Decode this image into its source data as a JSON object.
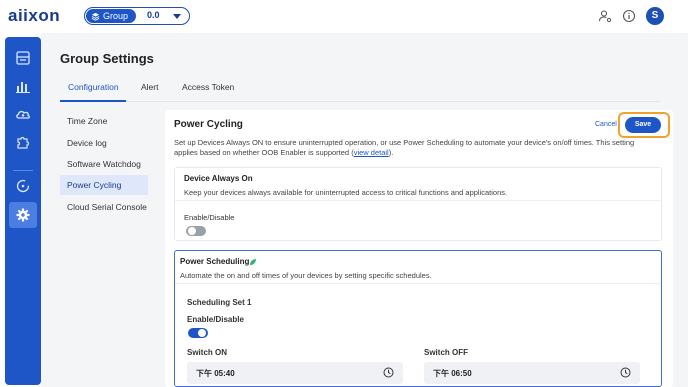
{
  "brand": {
    "logo_text": "aiixon"
  },
  "group_selector": {
    "label": "Group",
    "value": "0.0"
  },
  "user": {
    "avatar_initial": "S"
  },
  "page": {
    "title": "Group Settings",
    "tabs": [
      {
        "label": "Configuration",
        "active": true
      },
      {
        "label": "Alert",
        "active": false
      },
      {
        "label": "Access Token",
        "active": false
      }
    ]
  },
  "settings_menu": [
    {
      "label": "Time Zone",
      "active": false
    },
    {
      "label": "Device log",
      "active": false
    },
    {
      "label": "Software Watchdog",
      "active": false
    },
    {
      "label": "Power Cycling",
      "active": true
    },
    {
      "label": "Cloud Serial Console",
      "active": false
    }
  ],
  "power_cycling": {
    "title": "Power Cycling",
    "cancel_label": "Cancel",
    "save_label": "Save",
    "description": "Set up Devices Always ON to ensure uninterrupted operation, or use Power Scheduling to automate your device's on/off times. This setting applies based on whether OOB Enabler is supported (",
    "view_detail_label": "view detail",
    "description_end": ").",
    "always_on": {
      "title": "Device Always On",
      "description": "Keep your devices always available for uninterrupted access to critical functions and applications.",
      "toggle_label": "Enable/Disable",
      "enabled": false
    },
    "scheduling": {
      "title": "Power Scheduling",
      "description": "Automate the on and off times of your devices by setting specific schedules.",
      "set_title": "Scheduling Set 1",
      "toggle_label": "Enable/Disable",
      "enabled": true,
      "switch_on_label": "Switch ON",
      "switch_on_time": "下午 05:40",
      "switch_off_label": "Switch OFF",
      "switch_off_time": "下午 06:50"
    }
  },
  "colors": {
    "primary": "#1e56c8",
    "highlight": "#f0a22a",
    "sidebar": "#1e56c8"
  }
}
